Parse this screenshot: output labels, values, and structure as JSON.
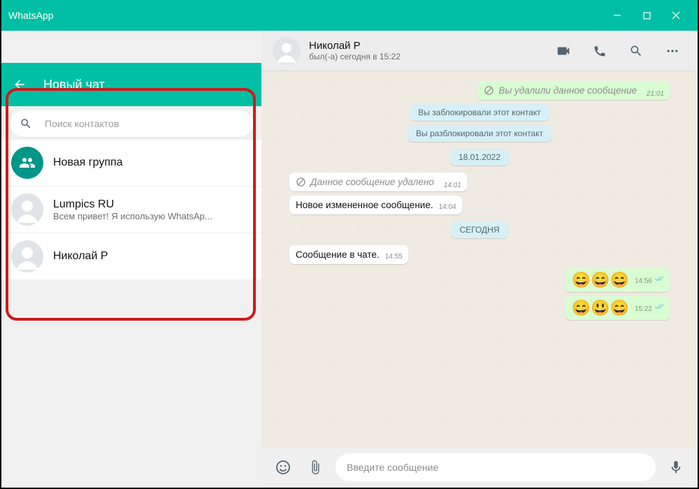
{
  "window": {
    "title": "WhatsApp"
  },
  "newchat": {
    "title": "Новый чат",
    "search_placeholder": "Поиск контактов",
    "new_group": "Новая группа",
    "contacts": [
      {
        "name": "Lumpics RU",
        "status": "Всем привет! Я использую WhatsAp..."
      },
      {
        "name": "Николай Р",
        "status": ""
      }
    ]
  },
  "chat": {
    "name": "Николай Р",
    "status": "был(-а) сегодня в 15:22",
    "input_placeholder": "Введите сообщение",
    "messages": {
      "deleted_out": "Вы удалили данное сообщение",
      "deleted_out_time": "21:01",
      "sys_blocked": "Вы заблокировали этот контакт",
      "sys_unblocked": "Вы разблокировали этот контакт",
      "date_divider1": "18.01.2022",
      "deleted_in": "Данное сообщение удалено",
      "deleted_in_time": "14:01",
      "in_text": "Новое измененное сообщение.",
      "in_text_time": "14:04",
      "date_divider2": "СЕГОДНЯ",
      "in_text2": "Сообщение в чате.",
      "in_text2_time": "14:55",
      "emoji1": "😄😄😄",
      "emoji1_time": "14:56",
      "emoji2": "😄😃😄",
      "emoji2_time": "15:22"
    }
  }
}
